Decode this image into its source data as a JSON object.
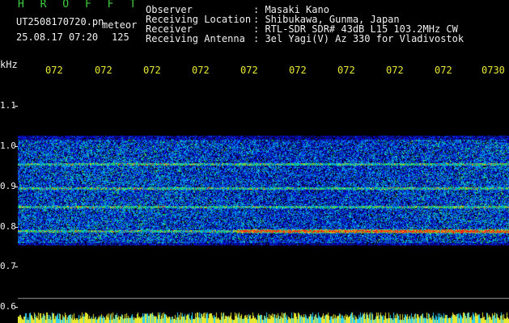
{
  "header": {
    "app_title": "H R O F F T",
    "filename": "UT2508170720.pn",
    "mode": "meteor",
    "datetime": "25.08.17 07:20",
    "count": "125"
  },
  "info": [
    {
      "key": "Observer",
      "value": ": Masaki Kano"
    },
    {
      "key": "Receiving Location",
      "value": ": Shibukawa, Gunma, Japan"
    },
    {
      "key": "Receiver",
      "value": ": RTL-SDR SDR# 43dB L15 103.2MHz CW"
    },
    {
      "key": "Receiving Antenna",
      "value": ": 3el Yagi(V) Az 330 for Vladivostok"
    }
  ],
  "axis": {
    "unit": "kHz",
    "y_ticks": [
      "1.1",
      "1.0",
      "0.9",
      "0.8",
      "0.7",
      "0.6"
    ],
    "x_ticks": [
      "072",
      "072",
      "072",
      "072",
      "072",
      "072",
      "072",
      "072",
      "072",
      "0730"
    ]
  },
  "colors": {
    "header_green": "#3fd23f",
    "label_white": "#f0f0f0",
    "tick_yellow": "#e8e830",
    "background": "#000000"
  }
}
